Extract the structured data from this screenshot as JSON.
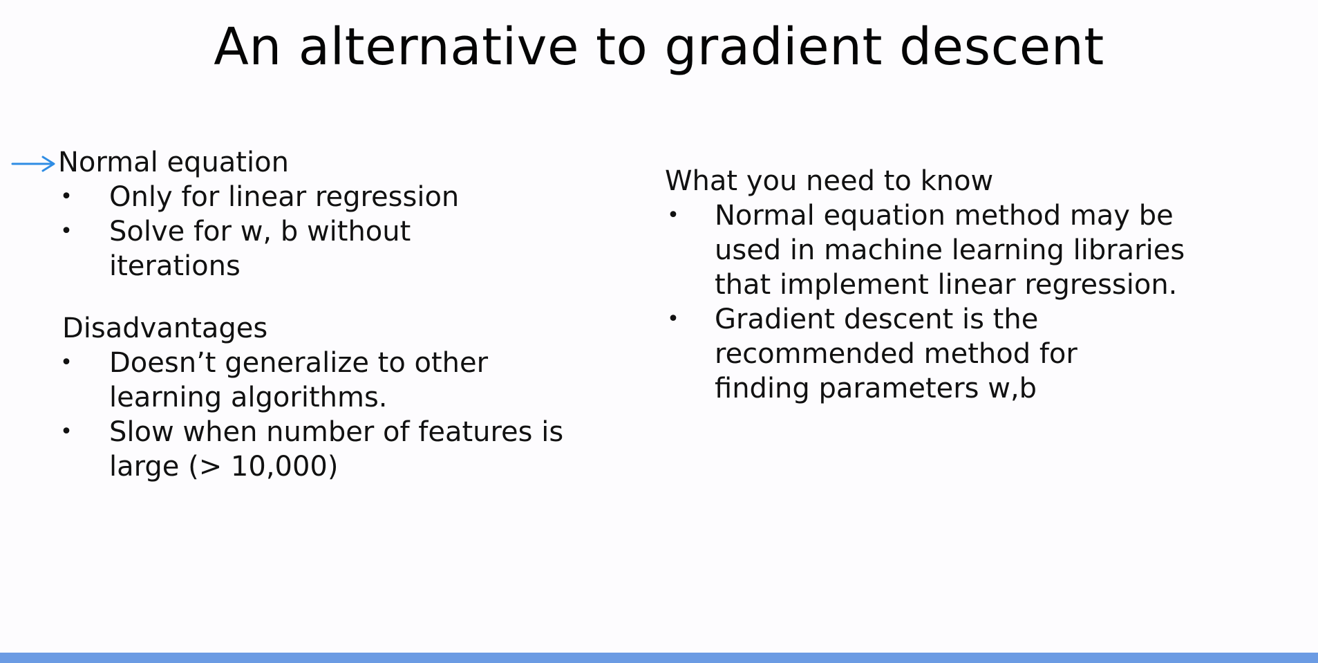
{
  "title": "An alternative to gradient descent",
  "left": {
    "heading": "Normal equation",
    "bullets": [
      "Only for linear regression",
      "Solve for w, b without iterations"
    ],
    "disadvantages_heading": "Disadvantages",
    "disadvantages": [
      "Doesn’t generalize to other learning algorithms.",
      "Slow when number of features is large (> 10,000)"
    ]
  },
  "right": {
    "heading": "What you need to know",
    "bullets": [
      "Normal equation method may be used in machine learning libraries that implement linear regression.",
      "Gradient descent is the recommended method for finding parameters w,b"
    ]
  },
  "bullet_glyph": "•",
  "colors": {
    "pointer_arrow": "#2f8de4",
    "bottom_bar": "#6b9be3"
  },
  "icons": {
    "pointer": "arrow-right-icon"
  }
}
